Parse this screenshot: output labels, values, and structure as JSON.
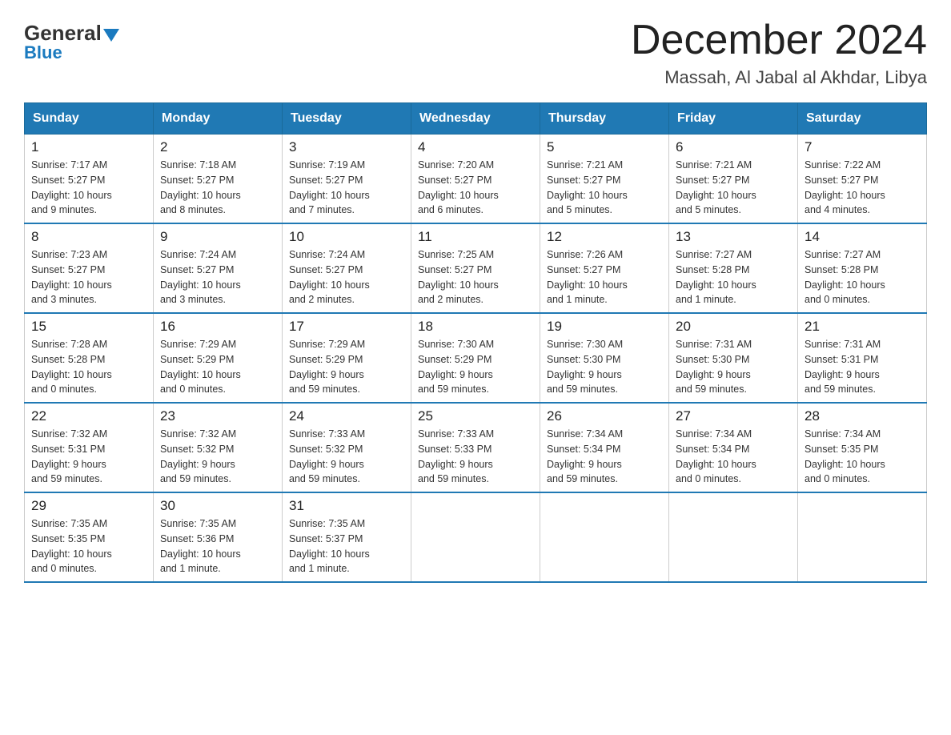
{
  "header": {
    "logo_general": "General",
    "logo_blue": "Blue",
    "month_title": "December 2024",
    "location": "Massah, Al Jabal al Akhdar, Libya"
  },
  "days_of_week": [
    "Sunday",
    "Monday",
    "Tuesday",
    "Wednesday",
    "Thursday",
    "Friday",
    "Saturday"
  ],
  "weeks": [
    [
      {
        "day": "1",
        "sunrise": "7:17 AM",
        "sunset": "5:27 PM",
        "daylight": "10 hours and 9 minutes."
      },
      {
        "day": "2",
        "sunrise": "7:18 AM",
        "sunset": "5:27 PM",
        "daylight": "10 hours and 8 minutes."
      },
      {
        "day": "3",
        "sunrise": "7:19 AM",
        "sunset": "5:27 PM",
        "daylight": "10 hours and 7 minutes."
      },
      {
        "day": "4",
        "sunrise": "7:20 AM",
        "sunset": "5:27 PM",
        "daylight": "10 hours and 6 minutes."
      },
      {
        "day": "5",
        "sunrise": "7:21 AM",
        "sunset": "5:27 PM",
        "daylight": "10 hours and 5 minutes."
      },
      {
        "day": "6",
        "sunrise": "7:21 AM",
        "sunset": "5:27 PM",
        "daylight": "10 hours and 5 minutes."
      },
      {
        "day": "7",
        "sunrise": "7:22 AM",
        "sunset": "5:27 PM",
        "daylight": "10 hours and 4 minutes."
      }
    ],
    [
      {
        "day": "8",
        "sunrise": "7:23 AM",
        "sunset": "5:27 PM",
        "daylight": "10 hours and 3 minutes."
      },
      {
        "day": "9",
        "sunrise": "7:24 AM",
        "sunset": "5:27 PM",
        "daylight": "10 hours and 3 minutes."
      },
      {
        "day": "10",
        "sunrise": "7:24 AM",
        "sunset": "5:27 PM",
        "daylight": "10 hours and 2 minutes."
      },
      {
        "day": "11",
        "sunrise": "7:25 AM",
        "sunset": "5:27 PM",
        "daylight": "10 hours and 2 minutes."
      },
      {
        "day": "12",
        "sunrise": "7:26 AM",
        "sunset": "5:27 PM",
        "daylight": "10 hours and 1 minute."
      },
      {
        "day": "13",
        "sunrise": "7:27 AM",
        "sunset": "5:28 PM",
        "daylight": "10 hours and 1 minute."
      },
      {
        "day": "14",
        "sunrise": "7:27 AM",
        "sunset": "5:28 PM",
        "daylight": "10 hours and 0 minutes."
      }
    ],
    [
      {
        "day": "15",
        "sunrise": "7:28 AM",
        "sunset": "5:28 PM",
        "daylight": "10 hours and 0 minutes."
      },
      {
        "day": "16",
        "sunrise": "7:29 AM",
        "sunset": "5:29 PM",
        "daylight": "10 hours and 0 minutes."
      },
      {
        "day": "17",
        "sunrise": "7:29 AM",
        "sunset": "5:29 PM",
        "daylight": "9 hours and 59 minutes."
      },
      {
        "day": "18",
        "sunrise": "7:30 AM",
        "sunset": "5:29 PM",
        "daylight": "9 hours and 59 minutes."
      },
      {
        "day": "19",
        "sunrise": "7:30 AM",
        "sunset": "5:30 PM",
        "daylight": "9 hours and 59 minutes."
      },
      {
        "day": "20",
        "sunrise": "7:31 AM",
        "sunset": "5:30 PM",
        "daylight": "9 hours and 59 minutes."
      },
      {
        "day": "21",
        "sunrise": "7:31 AM",
        "sunset": "5:31 PM",
        "daylight": "9 hours and 59 minutes."
      }
    ],
    [
      {
        "day": "22",
        "sunrise": "7:32 AM",
        "sunset": "5:31 PM",
        "daylight": "9 hours and 59 minutes."
      },
      {
        "day": "23",
        "sunrise": "7:32 AM",
        "sunset": "5:32 PM",
        "daylight": "9 hours and 59 minutes."
      },
      {
        "day": "24",
        "sunrise": "7:33 AM",
        "sunset": "5:32 PM",
        "daylight": "9 hours and 59 minutes."
      },
      {
        "day": "25",
        "sunrise": "7:33 AM",
        "sunset": "5:33 PM",
        "daylight": "9 hours and 59 minutes."
      },
      {
        "day": "26",
        "sunrise": "7:34 AM",
        "sunset": "5:34 PM",
        "daylight": "9 hours and 59 minutes."
      },
      {
        "day": "27",
        "sunrise": "7:34 AM",
        "sunset": "5:34 PM",
        "daylight": "10 hours and 0 minutes."
      },
      {
        "day": "28",
        "sunrise": "7:34 AM",
        "sunset": "5:35 PM",
        "daylight": "10 hours and 0 minutes."
      }
    ],
    [
      {
        "day": "29",
        "sunrise": "7:35 AM",
        "sunset": "5:35 PM",
        "daylight": "10 hours and 0 minutes."
      },
      {
        "day": "30",
        "sunrise": "7:35 AM",
        "sunset": "5:36 PM",
        "daylight": "10 hours and 1 minute."
      },
      {
        "day": "31",
        "sunrise": "7:35 AM",
        "sunset": "5:37 PM",
        "daylight": "10 hours and 1 minute."
      },
      null,
      null,
      null,
      null
    ]
  ],
  "labels": {
    "sunrise": "Sunrise:",
    "sunset": "Sunset:",
    "daylight": "Daylight:"
  }
}
